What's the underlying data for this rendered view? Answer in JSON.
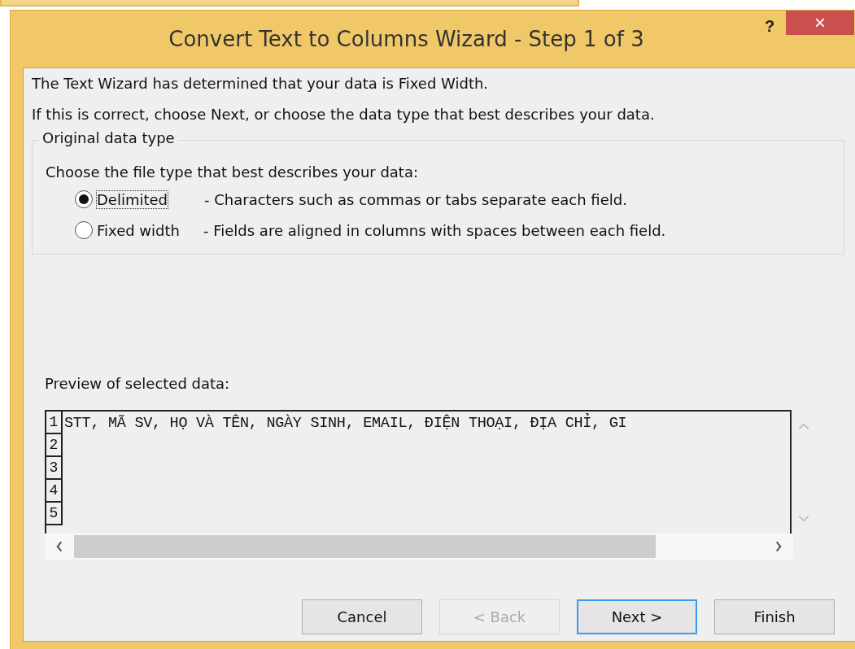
{
  "window": {
    "title": "Convert Text to Columns Wizard - Step 1 of 3",
    "help": "?",
    "close": "×"
  },
  "intro": [
    "The Text Wizard has determined that your data is Fixed Width.",
    "If this is correct, choose Next, or choose the data type that best describes your data."
  ],
  "group": {
    "title": "Original data type",
    "prompt": "Choose the file type that best describes your data:",
    "options": [
      {
        "label": "Delimited",
        "description": "- Characters such as commas or tabs separate each field.",
        "selected": true
      },
      {
        "label": "Fixed width",
        "description": "- Fields are aligned in columns with spaces between each field.",
        "selected": false
      }
    ]
  },
  "preview": {
    "label": "Preview of selected data:",
    "rows": [
      {
        "number": "1",
        "text": "STT, MÃ SV, HỌ VÀ TÊN, NGÀY SINH, EMAIL, ĐIỆN THOẠI, ĐỊA CHỈ, GI"
      },
      {
        "number": "2",
        "text": ""
      },
      {
        "number": "3",
        "text": ""
      },
      {
        "number": "4",
        "text": ""
      },
      {
        "number": "5",
        "text": ""
      }
    ]
  },
  "buttons": [
    {
      "label": "Cancel",
      "disabled": false,
      "focused": false
    },
    {
      "label": "< Back",
      "disabled": true,
      "focused": false
    },
    {
      "label": "Next >",
      "disabled": false,
      "focused": true
    },
    {
      "label": "Finish",
      "disabled": false,
      "focused": false
    }
  ]
}
